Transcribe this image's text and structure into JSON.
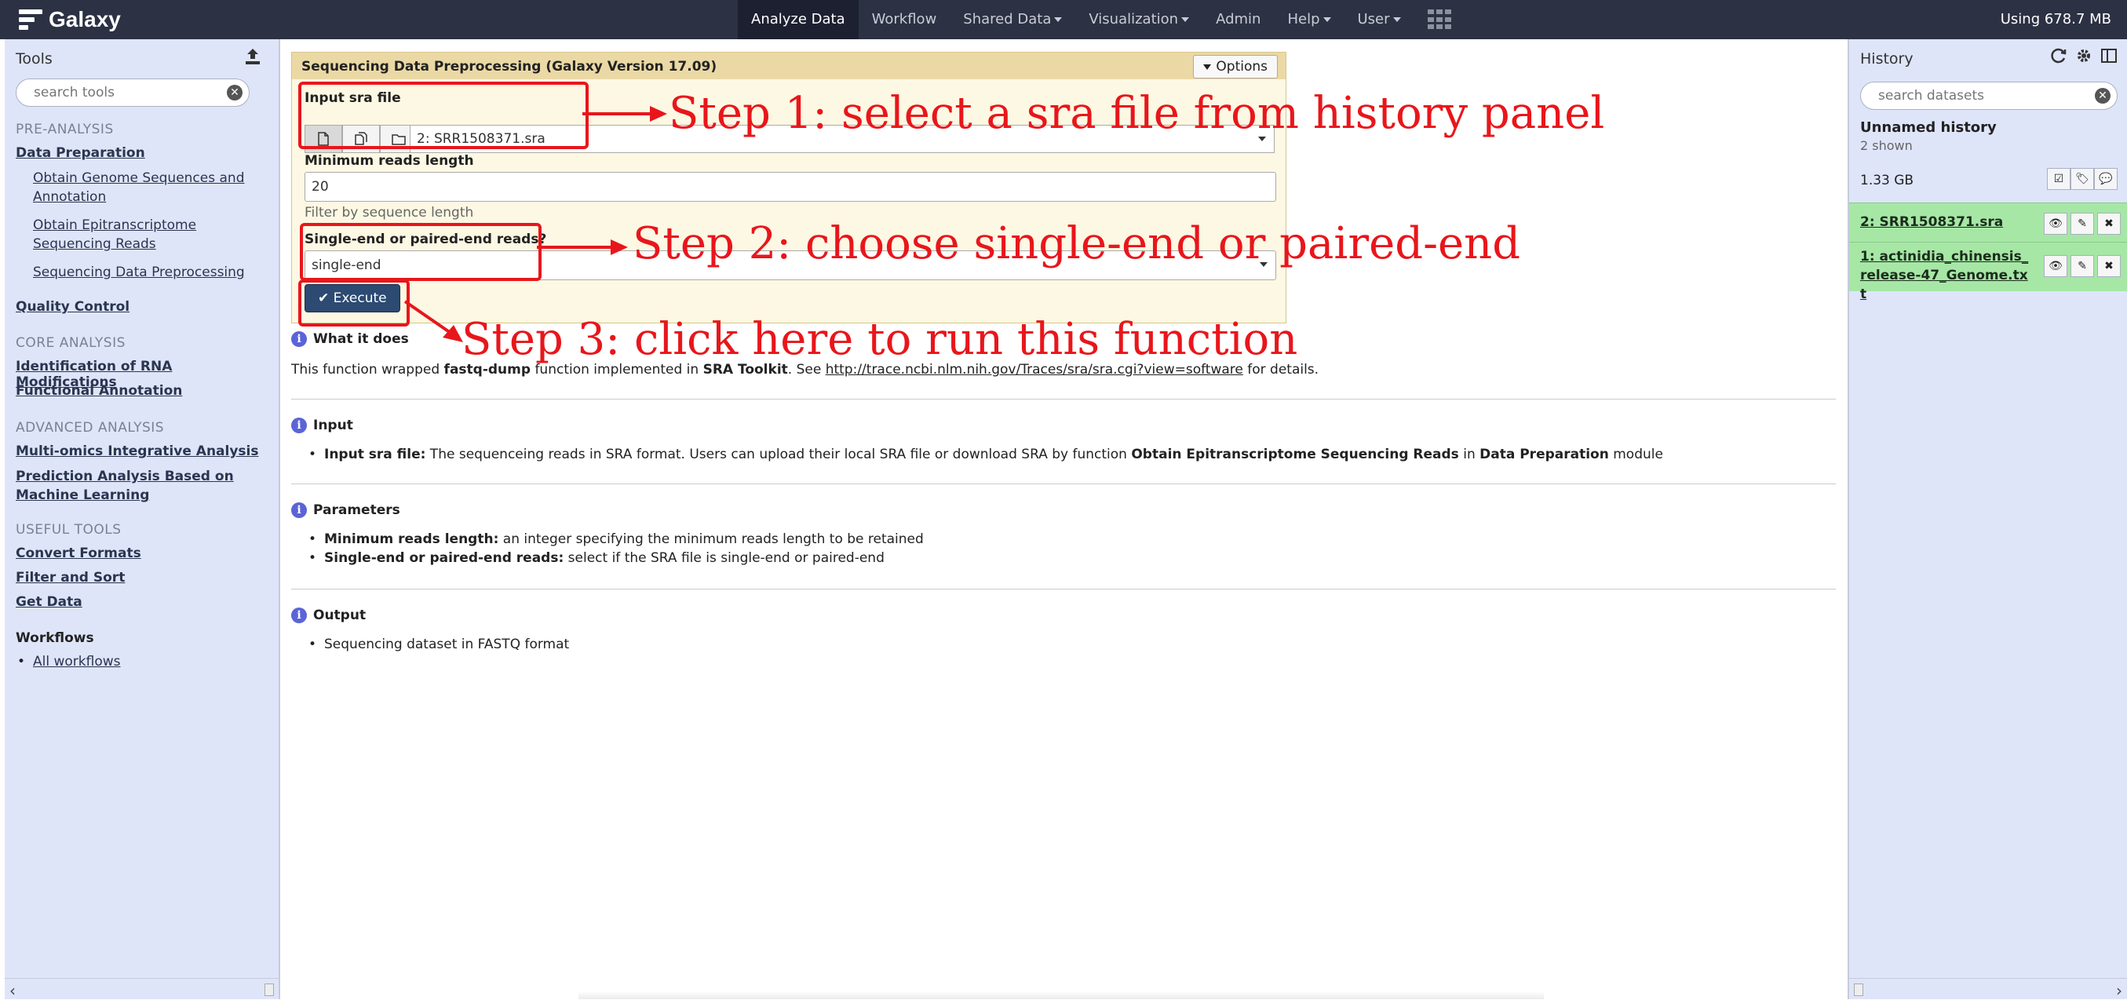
{
  "masthead": {
    "brand": "Galaxy",
    "nav": [
      {
        "label": "Analyze Data",
        "caret": false
      },
      {
        "label": "Workflow",
        "caret": false
      },
      {
        "label": "Shared Data",
        "caret": true
      },
      {
        "label": "Visualization",
        "caret": true
      },
      {
        "label": "Admin",
        "caret": false
      },
      {
        "label": "Help",
        "caret": true
      },
      {
        "label": "User",
        "caret": true
      }
    ],
    "quota": "Using 678.7 MB"
  },
  "tools": {
    "title": "Tools",
    "search_placeholder": "search tools",
    "pre_analysis": "PRE-ANALYSIS",
    "data_preparation": "Data Preparation",
    "obtain_genome": "Obtain Genome Sequences and Annotation",
    "obtain_reads": "Obtain Epitranscriptome Sequencing Reads",
    "seq_preprocessing": "Sequencing Data Preprocessing",
    "quality_control": "Quality Control",
    "core_analysis": "CORE ANALYSIS",
    "rna_mods": "Identification of RNA Modifications",
    "functional": "Functional Annotation",
    "advanced_analysis": "ADVANCED ANALYSIS",
    "multi_omics": "Multi-omics Integrative Analysis",
    "prediction": "Prediction Analysis Based on Machine Learning",
    "useful_tools": "USEFUL TOOLS",
    "convert": "Convert Formats",
    "filter_sort": "Filter and Sort",
    "get_data": "Get Data",
    "workflows": "Workflows",
    "all_workflows": "All workflows"
  },
  "history": {
    "title": "History",
    "search_placeholder": "search datasets",
    "name": "Unnamed history",
    "shown": "2 shown",
    "size": "1.33 GB",
    "datasets": [
      {
        "title": "2: SRR1508371.sra"
      },
      {
        "title": "1: actinidia_chinensis_release-47_Genome.txt"
      }
    ]
  },
  "form": {
    "title": "Sequencing Data Preprocessing (Galaxy Version 17.09)",
    "options": "Options",
    "input_label": "Input sra file",
    "input_value": "2: SRR1508371.sra",
    "min_len_label": "Minimum reads length",
    "min_len_value": "20",
    "min_len_help": "Filter by sequence length",
    "ends_label": "Single-end or paired-end reads?",
    "ends_value": "single-end",
    "execute": "Execute"
  },
  "help": {
    "what_title": "What it does",
    "what_pre": "This function wrapped ",
    "what_b1": "fastq-dump",
    "what_mid1": " function implemented in ",
    "what_b2": "SRA Toolkit",
    "what_mid2": ". See ",
    "what_link": "http://trace.ncbi.nlm.nih.gov/Traces/sra/sra.cgi?view=software",
    "what_post": " for details.",
    "input_title": "Input",
    "input_b": "Input sra file:",
    "input_t1": " The sequenceing reads in SRA format. Users can upload their local SRA file or download SRA by function ",
    "input_b2": "Obtain Epitranscriptome Sequencing Reads",
    "input_t2": " in ",
    "input_b3": "Data Preparation",
    "input_t3": " module",
    "params_title": "Parameters",
    "p1_b": "Minimum reads length:",
    "p1_t": " an integer specifying the minimum reads length to be retained",
    "p2_b": "Single-end or paired-end reads:",
    "p2_t": " select if the SRA file is single-end or paired-end",
    "output_title": "Output",
    "o1": "Sequencing dataset in FASTQ format"
  },
  "annotations": {
    "step1": "Step 1: select a sra file from history panel",
    "step2": "Step 2: choose single-end or paired-end",
    "step3": "Step 3: click here to run this function",
    "color": "#e8161b"
  }
}
